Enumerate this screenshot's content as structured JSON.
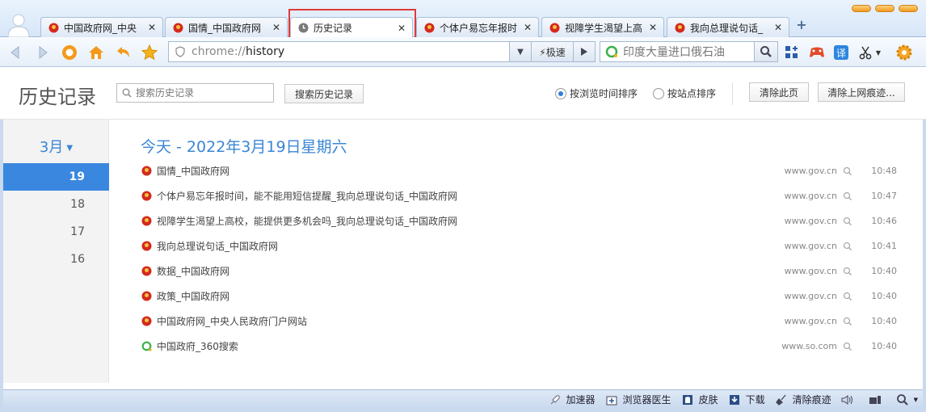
{
  "tabs": [
    {
      "title": "中国政府网_中央",
      "icon": "gov-emblem-icon",
      "active": false
    },
    {
      "title": "国情_中国政府网",
      "icon": "gov-emblem-icon",
      "active": false
    },
    {
      "title": "历史记录",
      "icon": "clock-icon",
      "active": true
    },
    {
      "title": "个体户易忘年报时",
      "icon": "gov-emblem-icon",
      "active": false
    },
    {
      "title": "视障学生渴望上高",
      "icon": "gov-emblem-icon",
      "active": false
    },
    {
      "title": "我向总理说句话_",
      "icon": "gov-emblem-icon",
      "active": false
    }
  ],
  "toolbar": {
    "url_prefix": "chrome://",
    "url_path": "history",
    "mode_label": "⚡极速",
    "search_placeholder": "印度大量进口俄石油"
  },
  "history": {
    "title": "历史记录",
    "search_placeholder": "搜索历史记录",
    "search_button": "搜索历史记录",
    "sort_by_time": "按浏览时间排序",
    "sort_by_site": "按站点排序",
    "clear_page": "清除此页",
    "clear_traces": "清除上网痕迹..."
  },
  "sidebar": {
    "month": "3月",
    "days": [
      {
        "label": "19",
        "active": true
      },
      {
        "label": "18",
        "active": false
      },
      {
        "label": "17",
        "active": false
      },
      {
        "label": "16",
        "active": false
      }
    ]
  },
  "list": {
    "date_heading": "今天 - 2022年3月19日星期六",
    "entries": [
      {
        "title": "国情_中国政府网",
        "domain": "www.gov.cn",
        "time": "10:48",
        "icon": "gov-emblem-icon"
      },
      {
        "title": "个体户易忘年报时间，能不能用短信提醒_我向总理说句话_中国政府网",
        "domain": "www.gov.cn",
        "time": "10:47",
        "icon": "gov-emblem-icon"
      },
      {
        "title": "视障学生渴望上高校，能提供更多机会吗_我向总理说句话_中国政府网",
        "domain": "www.gov.cn",
        "time": "10:46",
        "icon": "gov-emblem-icon"
      },
      {
        "title": "我向总理说句话_中国政府网",
        "domain": "www.gov.cn",
        "time": "10:41",
        "icon": "gov-emblem-icon"
      },
      {
        "title": "数据_中国政府网",
        "domain": "www.gov.cn",
        "time": "10:40",
        "icon": "gov-emblem-icon"
      },
      {
        "title": "政策_中国政府网",
        "domain": "www.gov.cn",
        "time": "10:40",
        "icon": "gov-emblem-icon"
      },
      {
        "title": "中国政府网_中央人民政府门户网站",
        "domain": "www.gov.cn",
        "time": "10:40",
        "icon": "gov-emblem-icon"
      },
      {
        "title": "中国政府_360搜索",
        "domain": "www.so.com",
        "time": "10:40",
        "icon": "so-search-icon"
      }
    ]
  },
  "statusbar": {
    "accelerator": "加速器",
    "doctor": "浏览器医生",
    "skin": "皮肤",
    "download": "下载",
    "clear": "清除痕迹"
  },
  "colors": {
    "accent": "#3a87e0",
    "heading": "#3a86d6",
    "highlight_box": "#e0393a"
  }
}
